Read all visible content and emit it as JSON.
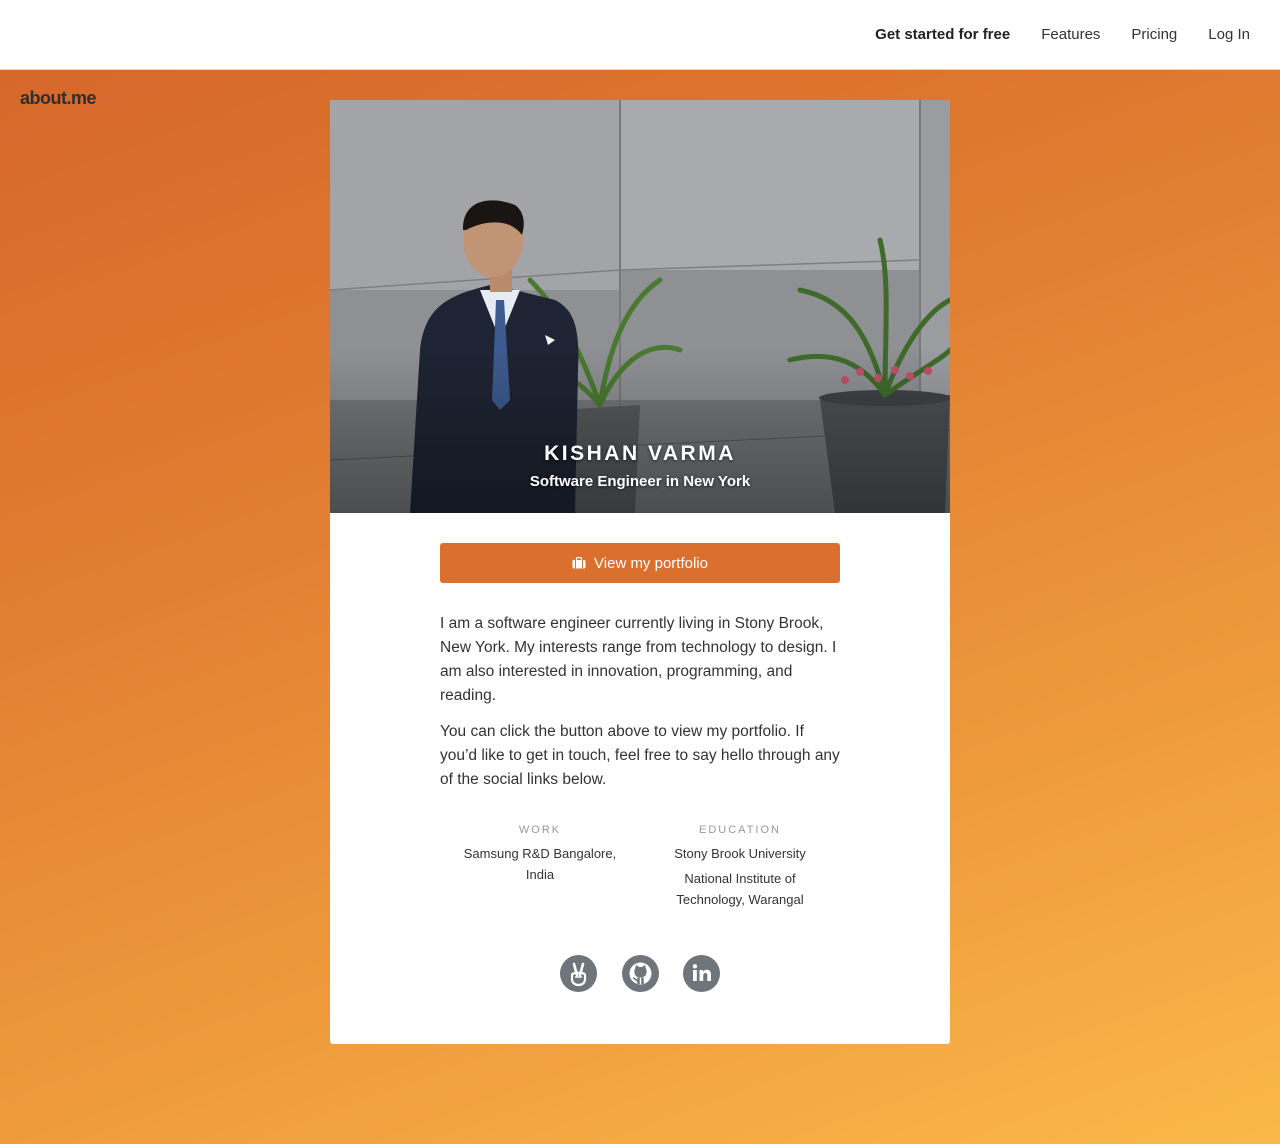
{
  "nav": {
    "get_started": "Get started for free",
    "features": "Features",
    "pricing": "Pricing",
    "login": "Log In"
  },
  "brand": {
    "logo": "about.me"
  },
  "profile": {
    "name": "KISHAN VARMA",
    "headline": "Software Engineer in New York",
    "portfolio_button": "View my portfolio",
    "bio": [
      "I am a software engineer currently living in Stony Brook, New York. My interests range from technology to design. I am also interested in innovation, programming, and reading.",
      "You can click the button above to view my portfolio. If you’d like to get in touch, feel free to say hello through any of the social links below."
    ],
    "work": {
      "heading": "WORK",
      "items": [
        "Samsung R&D Bangalore, India"
      ]
    },
    "education": {
      "heading": "EDUCATION",
      "items": [
        "Stony Brook University",
        "National Institute of Technology, Warangal"
      ]
    },
    "socials": [
      {
        "icon": "angellist-icon"
      },
      {
        "icon": "github-icon"
      },
      {
        "icon": "linkedin-icon"
      }
    ]
  },
  "colors": {
    "accent": "#db6f2d",
    "social": "#6e767b"
  }
}
